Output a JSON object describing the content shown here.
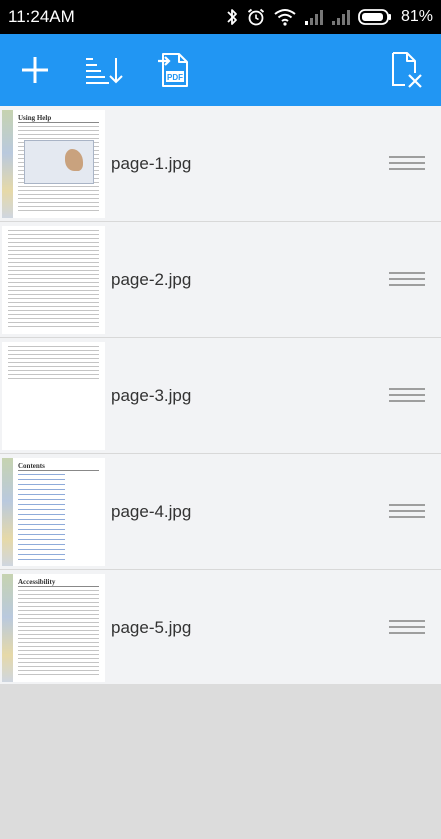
{
  "status_bar": {
    "time": "11:24AM",
    "battery": "81%",
    "icons": [
      "bluetooth-icon",
      "alarm-clock-icon",
      "wifi-icon",
      "signal-icon",
      "signal-icon",
      "battery-icon"
    ]
  },
  "toolbar": {
    "actions": [
      "add-icon",
      "sort-icon",
      "convert-to-pdf-icon",
      "clear-files-icon"
    ],
    "pdf_badge": "PDF",
    "background_color": "#2196f3"
  },
  "files": [
    {
      "name": "page-1.jpg",
      "thumb_heading": "Using Help"
    },
    {
      "name": "page-2.jpg",
      "thumb_heading": ""
    },
    {
      "name": "page-3.jpg",
      "thumb_heading": ""
    },
    {
      "name": "page-4.jpg",
      "thumb_heading": "Contents"
    },
    {
      "name": "page-5.jpg",
      "thumb_heading": "Accessibility"
    }
  ]
}
